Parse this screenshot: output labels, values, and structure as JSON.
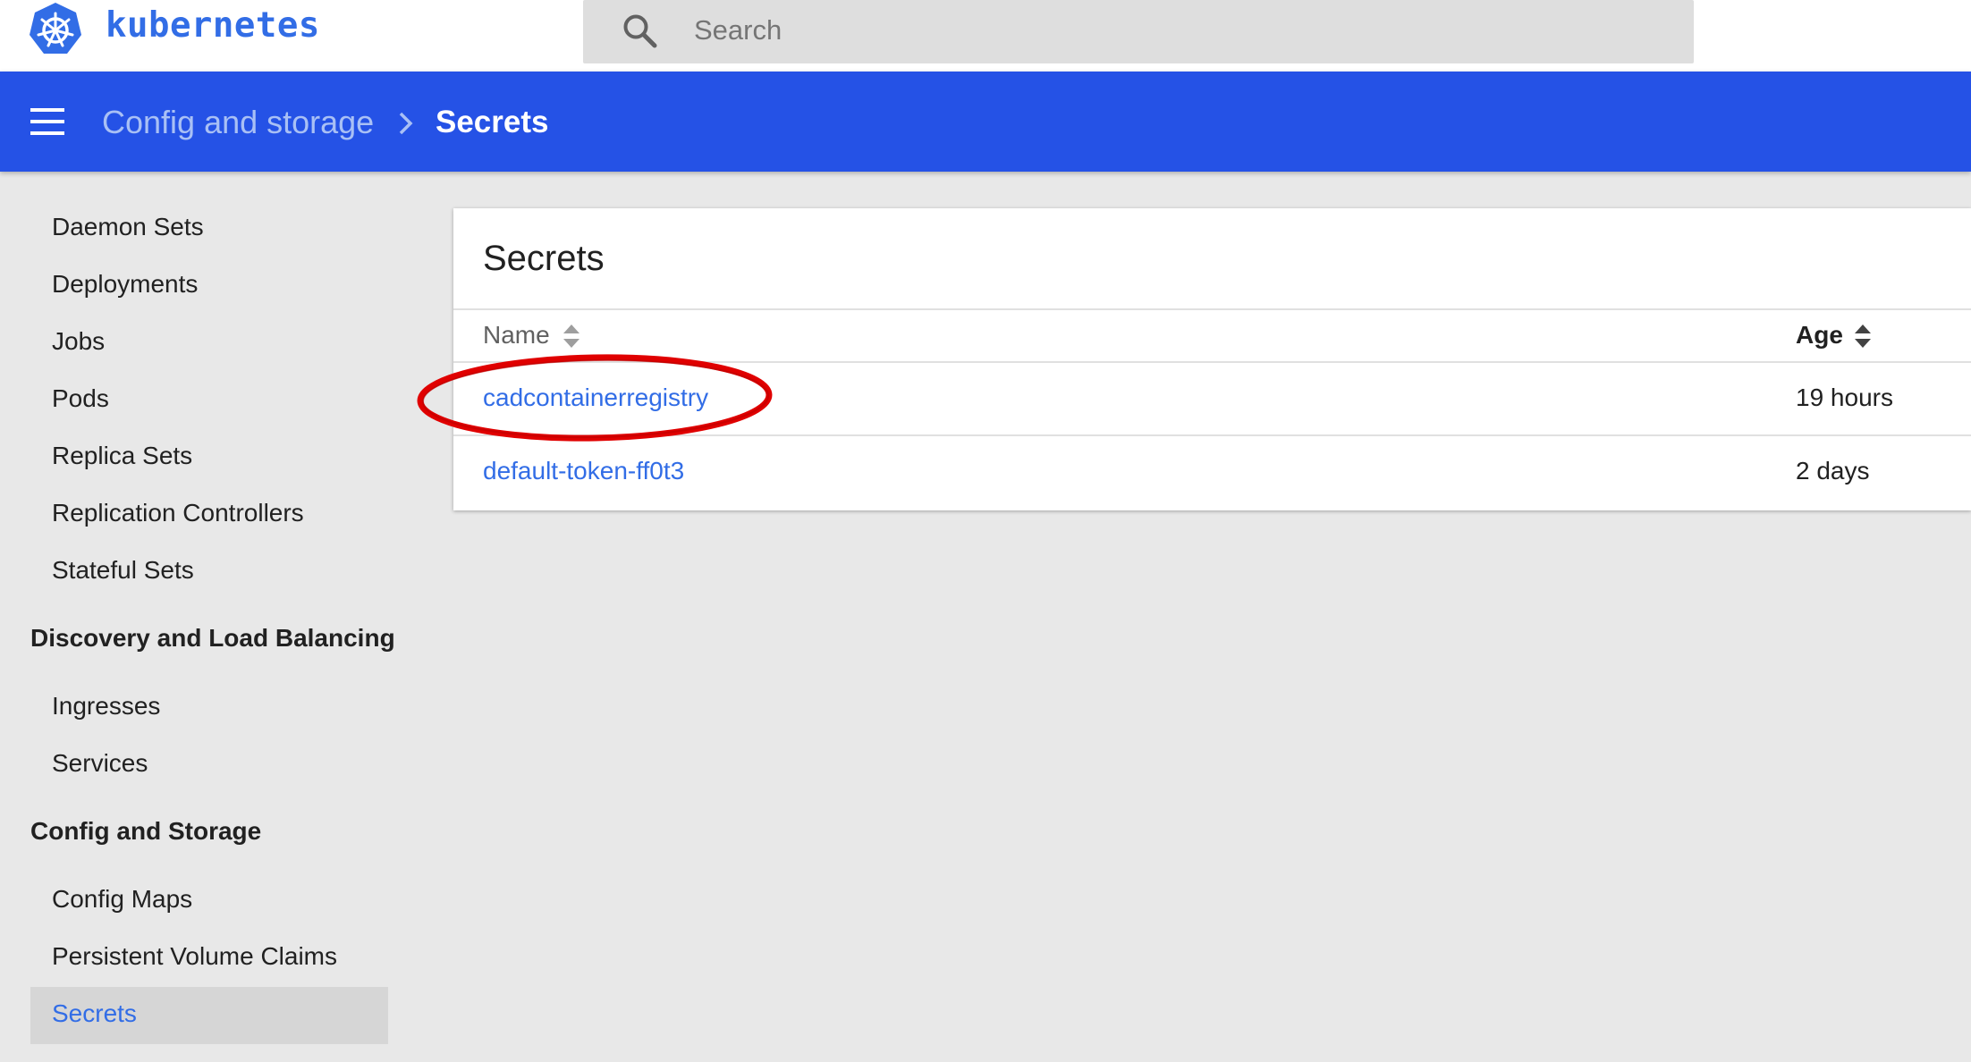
{
  "app": {
    "brand": "kubernetes",
    "brand_color": "#326de6",
    "logo_icon": "kubernetes-helm-logo"
  },
  "search": {
    "placeholder": "Search",
    "value": "",
    "icon": "search-icon"
  },
  "header": {
    "background": "#2552e6",
    "menu_icon": "hamburger-menu-icon",
    "breadcrumb": {
      "parent": "Config and storage",
      "separator_icon": "chevron-right-icon",
      "current": "Secrets"
    }
  },
  "sidebar": {
    "workloads_items": [
      {
        "label": "Daemon Sets"
      },
      {
        "label": "Deployments"
      },
      {
        "label": "Jobs"
      },
      {
        "label": "Pods"
      },
      {
        "label": "Replica Sets"
      },
      {
        "label": "Replication Controllers"
      },
      {
        "label": "Stateful Sets"
      }
    ],
    "discovery": {
      "title": "Discovery and Load Balancing",
      "items": [
        {
          "label": "Ingresses"
        },
        {
          "label": "Services"
        }
      ]
    },
    "config": {
      "title": "Config and Storage",
      "items": [
        {
          "label": "Config Maps"
        },
        {
          "label": "Persistent Volume Claims"
        },
        {
          "label": "Secrets",
          "active": true
        }
      ]
    }
  },
  "main": {
    "card_title": "Secrets",
    "columns": {
      "name": "Name",
      "age": "Age",
      "sort_icon": "sort-arrows-icon"
    },
    "rows": [
      {
        "name": "cadcontainerregistry",
        "age": "19 hours",
        "highlighted": true
      },
      {
        "name": "default-token-ff0t3",
        "age": "2 days",
        "highlighted": false
      }
    ],
    "annotation_color": "#e00000"
  }
}
